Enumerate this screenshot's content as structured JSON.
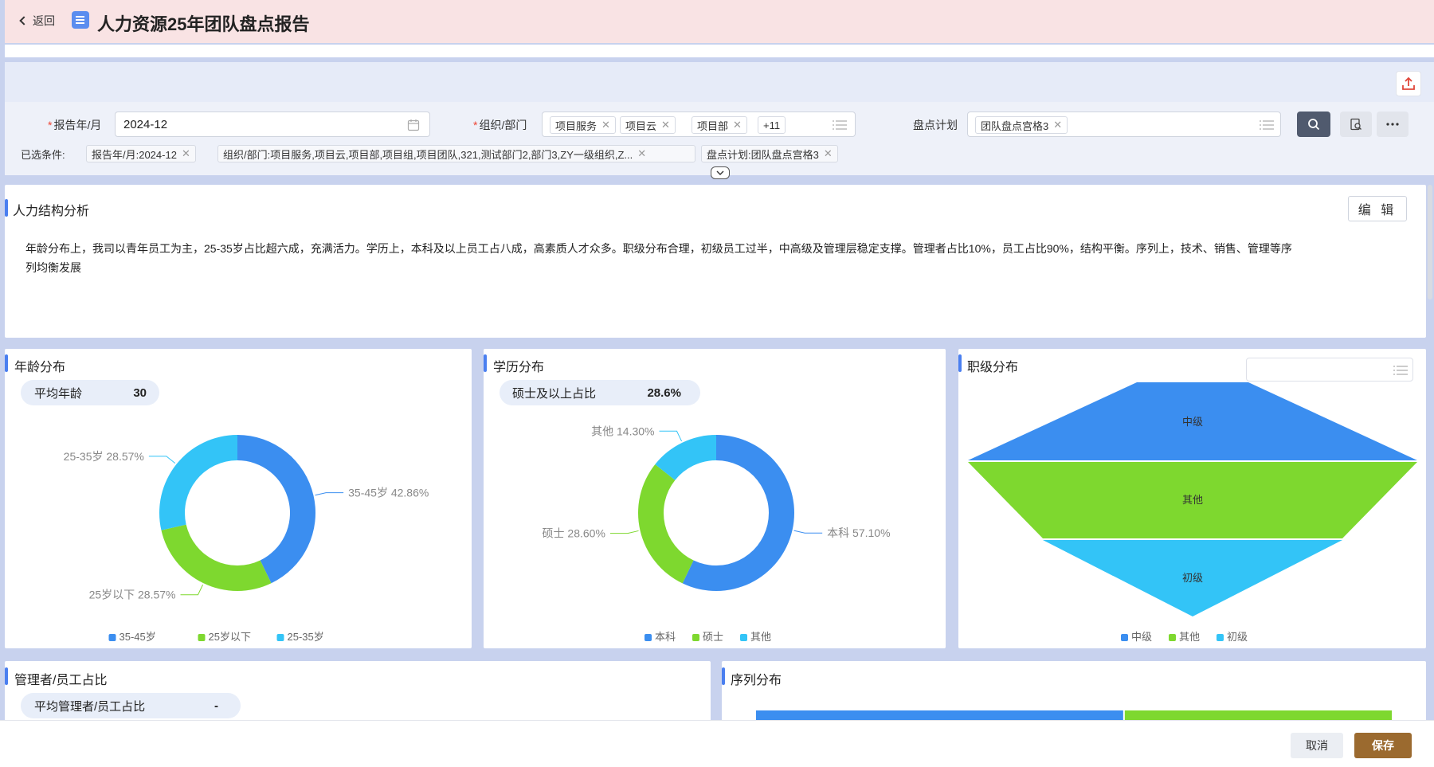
{
  "header": {
    "back_label": "返回",
    "title": "人力资源25年团队盘点报告"
  },
  "filters": {
    "report_month": {
      "label": "报告年/月",
      "value": "2024-12"
    },
    "org": {
      "label": "组织/部门",
      "tags": [
        "项目服务",
        "项目云",
        "项目部"
      ],
      "more": "+11"
    },
    "plan": {
      "label": "盘点计划",
      "tags": [
        "团队盘点宫格3"
      ]
    },
    "selected_label": "已选条件:",
    "selected": [
      "报告年/月:2024-12",
      "组织/部门:项目服务,项目云,项目部,项目组,项目团队,321,测试部门2,部门3,ZY一级组织,Z...",
      "盘点计划:团队盘点宫格3"
    ]
  },
  "analysis": {
    "title": "人力结构分析",
    "edit_label": "编 辑",
    "text": "年龄分布上，我司以青年员工为主，25-35岁占比超六成，充满活力。学历上，本科及以上员工占八成，高素质人才众多。职级分布合理，初级员工过半，中高级及管理层稳定支撑。管理者占比10%，员工占比90%，结构平衡。序列上，技术、销售、管理等序列均衡发展"
  },
  "age_card": {
    "title": "年龄分布",
    "stat_label": "平均年龄",
    "stat_value": "30"
  },
  "edu_card": {
    "title": "学历分布",
    "stat_label": "硕士及以上占比",
    "stat_value": "28.6%"
  },
  "level_card": {
    "title": "职级分布"
  },
  "mgr_card": {
    "title": "管理者/员工占比",
    "stat_label": "平均管理者/员工占比",
    "stat_value": "-"
  },
  "seq_card": {
    "title": "序列分布"
  },
  "footer": {
    "cancel_label": "取消",
    "save_label": "保存"
  },
  "colors": {
    "blue": "#3b8ef0",
    "green": "#7ed82f",
    "cyan": "#33c4f7",
    "accent": "#4a7ff0",
    "save": "#9b6a2f"
  },
  "chart_data": [
    {
      "type": "pie",
      "title": "年龄分布",
      "categories": [
        "35-45岁",
        "25岁以下",
        "25-35岁"
      ],
      "values": [
        42.86,
        28.57,
        28.57
      ],
      "labels": [
        "35-45岁 42.86%",
        "25岁以下 28.57%",
        "25-35岁 28.57%"
      ],
      "legend": "bottom"
    },
    {
      "type": "pie",
      "title": "学历分布",
      "categories": [
        "本科",
        "硕士",
        "其他"
      ],
      "values": [
        57.1,
        28.6,
        14.3
      ],
      "labels": [
        "本科 57.10%",
        "硕士 28.60%",
        "其他 14.30%"
      ],
      "legend": "bottom"
    },
    {
      "type": "funnel",
      "title": "职级分布",
      "categories": [
        "中级",
        "其他",
        "初级"
      ],
      "legend": "bottom"
    },
    {
      "type": "bar",
      "title": "序列分布",
      "values": [
        58,
        42
      ],
      "legend": "bottom"
    }
  ]
}
